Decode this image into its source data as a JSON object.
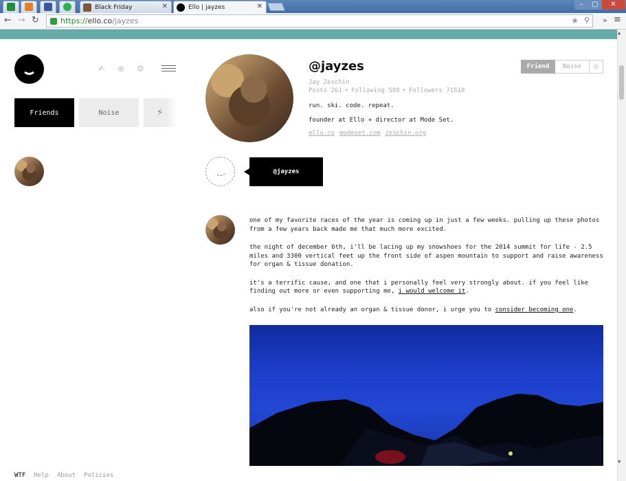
{
  "browser": {
    "tabs": [
      {
        "title": "",
        "icon": "sheets-icon",
        "color": "#1f8c3e"
      },
      {
        "title": "",
        "icon": "analytics-icon",
        "color": "#e0802a"
      },
      {
        "title": "",
        "icon": "facebook-icon",
        "color": "#3b5998"
      },
      {
        "title": "",
        "icon": "feedly-icon",
        "color": "#2bb24c"
      },
      {
        "title": "Black Friday",
        "icon": "goodreads-icon",
        "color": "#7a5a3a"
      },
      {
        "title": "Ello | jayzes",
        "icon": "ello-icon",
        "color": "#000000",
        "active": true
      }
    ],
    "url_scheme": "https://",
    "url_host": "ello.co",
    "url_path": "/jayzes"
  },
  "nav": {
    "streams": {
      "friends": "Friends",
      "noise": "Noise",
      "notifications_icon": "⚡"
    },
    "icons": [
      "invite-icon",
      "add-icon",
      "settings-icon",
      "menu-icon"
    ]
  },
  "profile": {
    "handle": "@jayzes",
    "name": "Jay Zeschin",
    "stats": {
      "posts": "Posts 261",
      "following": "Following 588",
      "followers": "Followers 71610",
      "sep": "•"
    },
    "bio_lines": [
      "run. ski. code. repeat.",
      "founder at Ello + director at Mode Set."
    ],
    "links": [
      "ello.co",
      "modeset.com",
      "zeschin.org"
    ],
    "relationship": {
      "friend": "Friend",
      "noise": "Noise",
      "block": "⊘"
    }
  },
  "repost": {
    "author_tag": "@jayzes"
  },
  "post": {
    "p1": "one of my favorite races of the year is coming up in just a few weeks. pulling up these photos from a few years back made me that much more excited.",
    "p2": "the night of december 6th, i'll be lacing up my snowshoes for the 2014 summit for life - 2.5 miles and 3300 vertical feet up the front side of aspen mountain to support and raise awareness for organ & tissue donation.",
    "p3_before": "it's a terrific cause, and one that i personally feel very strongly about. if you feel like finding out more or even supporting me, ",
    "p3_link": "i would welcome it",
    "p3_after": ".",
    "p4_before": "also if you're not already an organ & tissue donor, i urge you to ",
    "p4_link": "consider becoming one",
    "p4_after": "."
  },
  "footer": {
    "links": [
      "WTF",
      "Help",
      "About",
      "Policies"
    ]
  },
  "colors": {
    "accent_teal": "#66aaa7"
  }
}
